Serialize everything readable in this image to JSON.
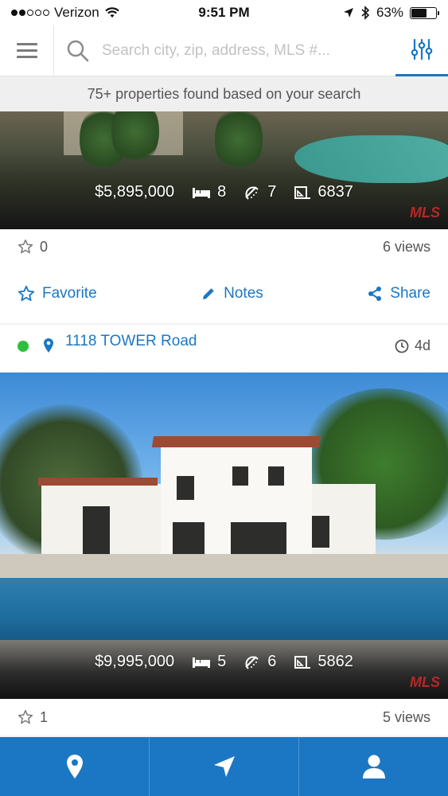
{
  "status_bar": {
    "carrier": "Verizon",
    "time": "9:51 PM",
    "battery": "63%",
    "battery_level": 0.63,
    "signal_bars_filled": 2,
    "signal_bars_total": 5
  },
  "search": {
    "placeholder": "Search city, zip, address, MLS #...",
    "value": ""
  },
  "results_banner": "75+ properties found based on your search",
  "listings": [
    {
      "price": "$5,895,000",
      "beds": "8",
      "baths": "7",
      "sqft": "6837",
      "favorites": "0",
      "views": "6 views",
      "actions": {
        "favorite": "Favorite",
        "notes": "Notes",
        "share": "Share"
      },
      "mls_badge": "MLS"
    },
    {
      "address": "1118 TOWER Road",
      "age": "4d",
      "price": "$9,995,000",
      "beds": "5",
      "baths": "6",
      "sqft": "5862",
      "favorites": "1",
      "views": "5 views",
      "mls_badge": "MLS"
    }
  ],
  "colors": {
    "accent": "#1b77c3",
    "active_dot": "#2fbf3a",
    "tabbar_bg": "#1b77c3"
  },
  "tabbar": {
    "icons": [
      "map-pin-icon",
      "navigation-icon",
      "user-icon"
    ]
  }
}
